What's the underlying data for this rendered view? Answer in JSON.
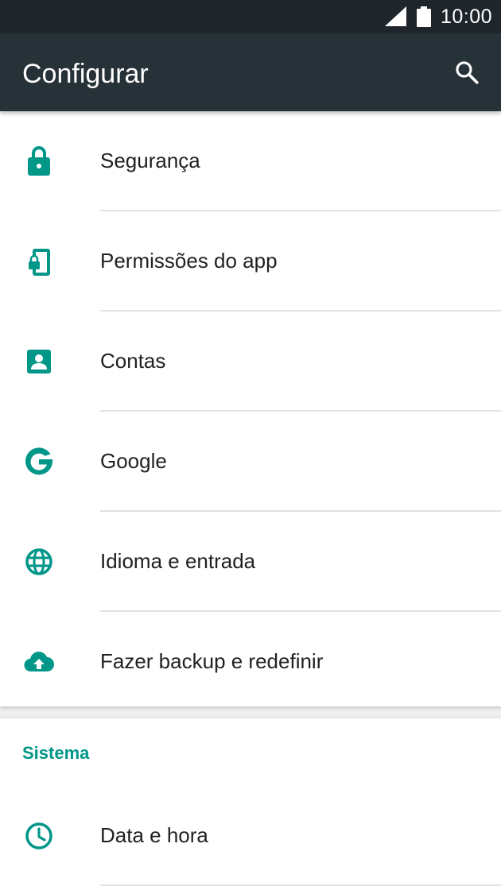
{
  "status_bar": {
    "time": "10:00",
    "icons": [
      "signal-icon",
      "battery-icon"
    ]
  },
  "toolbar": {
    "title": "Configurar",
    "search_icon": "search-icon"
  },
  "accent_color": "#009688",
  "toolbar_color": "#263238",
  "status_bar_color": "#1e252b",
  "personal_items": [
    {
      "label": "Segurança",
      "icon": "lock-icon"
    },
    {
      "label": "Permissões do app",
      "icon": "app-permissions-icon"
    },
    {
      "label": "Contas",
      "icon": "account-icon"
    },
    {
      "label": "Google",
      "icon": "google-icon"
    },
    {
      "label": "Idioma e entrada",
      "icon": "globe-icon"
    },
    {
      "label": "Fazer backup e redefinir",
      "icon": "cloud-upload-icon"
    }
  ],
  "system_section": {
    "header": "Sistema",
    "items": [
      {
        "label": "Data e hora",
        "icon": "clock-icon"
      }
    ]
  }
}
